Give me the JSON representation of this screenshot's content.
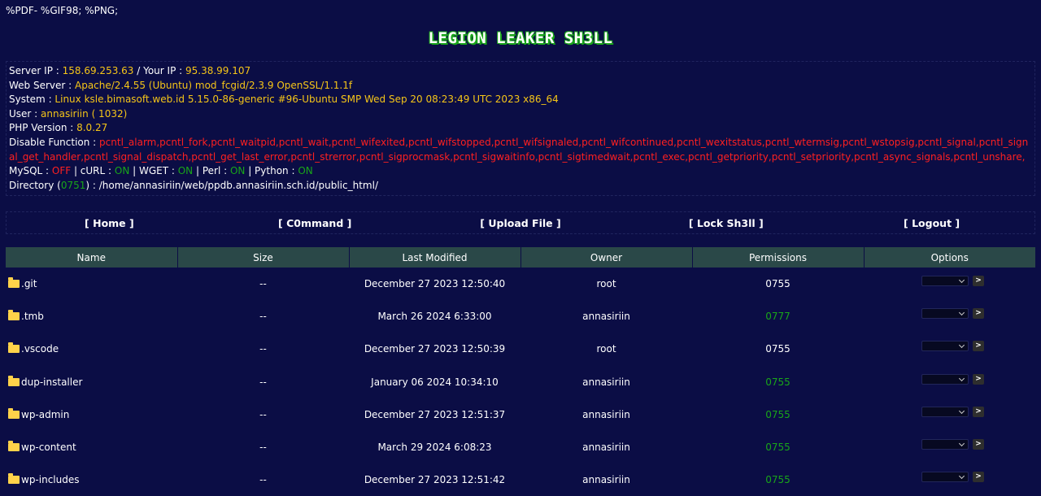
{
  "header": {
    "magic": "%PDF- %GIF98; %PNG;",
    "title": "LEGION LEAKER SH3LL"
  },
  "info": {
    "server_ip_label": "Server IP : ",
    "server_ip": "158.69.253.63",
    "your_ip_label": " / Your IP : ",
    "your_ip": "95.38.99.107",
    "web_server_label": "Web Server : ",
    "web_server": "Apache/2.4.55 (Ubuntu) mod_fcgid/2.3.9 OpenSSL/1.1.1f",
    "system_label": "System : ",
    "system": "Linux ksle.bimasoft.web.id 5.15.0-86-generic #96-Ubuntu SMP Wed Sep 20 08:23:49 UTC 2023 x86_64",
    "user_label": "User : ",
    "user": "annasiriin",
    "user_id": " ( 1032)",
    "php_label": "PHP Version : ",
    "php": "8.0.27",
    "disable_label": "Disable Function : ",
    "disable": "pcntl_alarm,pcntl_fork,pcntl_waitpid,pcntl_wait,pcntl_wifexited,pcntl_wifstopped,pcntl_wifsignaled,pcntl_wifcontinued,pcntl_wexitstatus,pcntl_wtermsig,pcntl_wstopsig,pcntl_signal,pcntl_signal_get_handler,pcntl_signal_dispatch,pcntl_get_last_error,pcntl_strerror,pcntl_sigprocmask,pcntl_sigwaitinfo,pcntl_sigtimedwait,pcntl_exec,pcntl_getpriority,pcntl_setpriority,pcntl_async_signals,pcntl_unshare,",
    "mysql_label": "MySQL : ",
    "mysql": "OFF",
    "curl_label": " | cURL : ",
    "curl": "ON",
    "wget_label": " | WGET : ",
    "wget": "ON",
    "perl_label": " | Perl : ",
    "perl": "ON",
    "python_label": " | Python : ",
    "python": "ON",
    "dir_label": "Directory (",
    "dir_perm": "0751",
    "dir_sep": ") : ",
    "dir_path": "/home/annasiriin/web/ppdb.annasiriin.sch.id/public_html/"
  },
  "menu": [
    "[ Home ]",
    "[ C0mmand ]",
    "[ Upload File ]",
    "[ Lock Sh3ll ]",
    "[ Logout ]"
  ],
  "table": {
    "headers": [
      "Name",
      "Size",
      "Last Modified",
      "Owner",
      "Permissions",
      "Options"
    ],
    "rows": [
      {
        "name": ".git",
        "size": "--",
        "modified": "December 27 2023 12:50:40",
        "owner": "root",
        "perm": "0755",
        "perm_color": "#ffffff"
      },
      {
        "name": ".tmb",
        "size": "--",
        "modified": "March 26 2024 6:33:00",
        "owner": "annasiriin",
        "perm": "0777",
        "perm_color": "#19a619"
      },
      {
        "name": ".vscode",
        "size": "--",
        "modified": "December 27 2023 12:50:39",
        "owner": "root",
        "perm": "0755",
        "perm_color": "#ffffff"
      },
      {
        "name": "dup-installer",
        "size": "--",
        "modified": "January 06 2024 10:34:10",
        "owner": "annasiriin",
        "perm": "0755",
        "perm_color": "#19a619"
      },
      {
        "name": "wp-admin",
        "size": "--",
        "modified": "December 27 2023 12:51:37",
        "owner": "annasiriin",
        "perm": "0755",
        "perm_color": "#19a619"
      },
      {
        "name": "wp-content",
        "size": "--",
        "modified": "March 29 2024 6:08:23",
        "owner": "annasiriin",
        "perm": "0755",
        "perm_color": "#19a619"
      },
      {
        "name": "wp-includes",
        "size": "--",
        "modified": "December 27 2023 12:51:42",
        "owner": "annasiriin",
        "perm": "0755",
        "perm_color": "#19a619"
      }
    ],
    "go_label": ">"
  }
}
